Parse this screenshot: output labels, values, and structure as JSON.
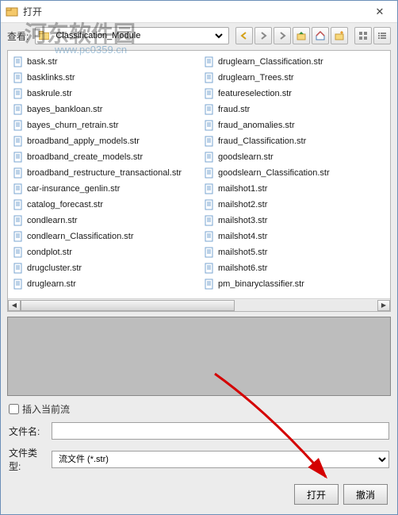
{
  "window": {
    "title": "打开"
  },
  "toolbar": {
    "look_in_label": "查看:",
    "location_value": "Classification_Module"
  },
  "files_left": [
    "bask.str",
    "basklinks.str",
    "baskrule.str",
    "bayes_bankloan.str",
    "bayes_churn_retrain.str",
    "broadband_apply_models.str",
    "broadband_create_models.str",
    "broadband_restructure_transactional.str",
    "car-insurance_genlin.str",
    "catalog_forecast.str",
    "condlearn.str",
    "condlearn_Classification.str",
    "condplot.str",
    "drugcluster.str",
    "druglearn.str"
  ],
  "files_right": [
    "druglearn_Classification.str",
    "druglearn_Trees.str",
    "featureselection.str",
    "fraud.str",
    "fraud_anomalies.str",
    "fraud_Classification.str",
    "goodslearn.str",
    "goodslearn_Classification.str",
    "mailshot1.str",
    "mailshot2.str",
    "mailshot3.str",
    "mailshot4.str",
    "mailshot5.str",
    "mailshot6.str",
    "pm_binaryclassifier.str"
  ],
  "options": {
    "insert_current_stream": "插入当前流"
  },
  "filename": {
    "label": "文件名:",
    "value": ""
  },
  "filetype": {
    "label": "文件类型:",
    "value": "流文件 (*.str)"
  },
  "buttons": {
    "open": "打开",
    "cancel": "撤消"
  },
  "watermark": {
    "text": "河东软件园",
    "url": "www.pc0359.cn"
  }
}
